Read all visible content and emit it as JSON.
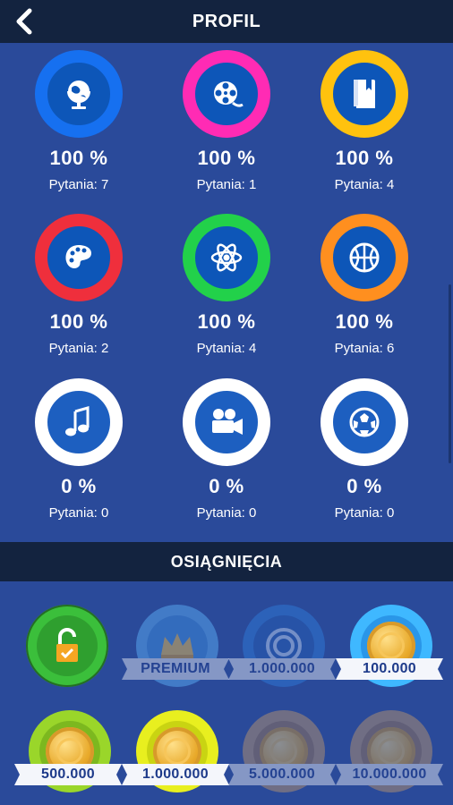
{
  "header": {
    "title": "PROFIL",
    "back_icon": "chevron-left-icon"
  },
  "categories": [
    {
      "id": "geography",
      "icon": "globe-icon",
      "color": "#1670f0",
      "percent": "100 %",
      "questions": "Pytania: 7"
    },
    {
      "id": "movies",
      "icon": "film-reel-icon",
      "color": "#ff2bb4",
      "percent": "100 %",
      "questions": "Pytania: 1"
    },
    {
      "id": "literature",
      "icon": "book-icon",
      "color": "#ffc20e",
      "percent": "100 %",
      "questions": "Pytania: 4"
    },
    {
      "id": "art",
      "icon": "palette-icon",
      "color": "#ef2f3c",
      "percent": "100 %",
      "questions": "Pytania: 2"
    },
    {
      "id": "science",
      "icon": "atom-icon",
      "color": "#22d14a",
      "percent": "100 %",
      "questions": "Pytania: 4"
    },
    {
      "id": "sport",
      "icon": "basketball-icon",
      "color": "#ff8f1f",
      "percent": "100 %",
      "questions": "Pytania: 6"
    },
    {
      "id": "music",
      "icon": "music-note-icon",
      "color": "#ffffff",
      "percent": "0 %",
      "questions": "Pytania: 0"
    },
    {
      "id": "cinema",
      "icon": "movie-camera-icon",
      "color": "#ffffff",
      "percent": "0 %",
      "questions": "Pytania: 0"
    },
    {
      "id": "football",
      "icon": "soccer-ball-icon",
      "color": "#ffffff",
      "percent": "0 %",
      "questions": "Pytania: 0"
    }
  ],
  "achievements_title": "OSIĄGNIĘCIA",
  "achievements": [
    {
      "label": "",
      "icon": "unlocked-padlock-icon",
      "ring": "#3bbf3b",
      "inner": "#2f9f2f",
      "unlocked": true
    },
    {
      "label": "PREMIUM",
      "icon": "crown-icon",
      "ring": "#5fb7ff",
      "inner": "#3f96e8",
      "unlocked": false
    },
    {
      "label": "1.000.000",
      "icon": "target-icon",
      "ring": "#2f7fe0",
      "inner": "#245fb8",
      "unlocked": false
    },
    {
      "label": "100.000",
      "icon": "coin-icon",
      "ring": "#3fb8ff",
      "inner": "#2a96e8",
      "unlocked": true
    },
    {
      "label": "500.000",
      "icon": "coin-icon",
      "ring": "#9ad62a",
      "inner": "#7cb81f",
      "unlocked": true
    },
    {
      "label": "1.000.000",
      "icon": "coin-icon",
      "ring": "#e8ef1f",
      "inner": "#c9d412",
      "unlocked": true
    },
    {
      "label": "5.000.000",
      "icon": "coin-icon",
      "ring": "#c59a6a",
      "inner": "#a57a4f",
      "unlocked": false
    },
    {
      "label": "10.000.000",
      "icon": "coin-icon",
      "ring": "#c59a6a",
      "inner": "#a57a4f",
      "unlocked": false
    }
  ]
}
